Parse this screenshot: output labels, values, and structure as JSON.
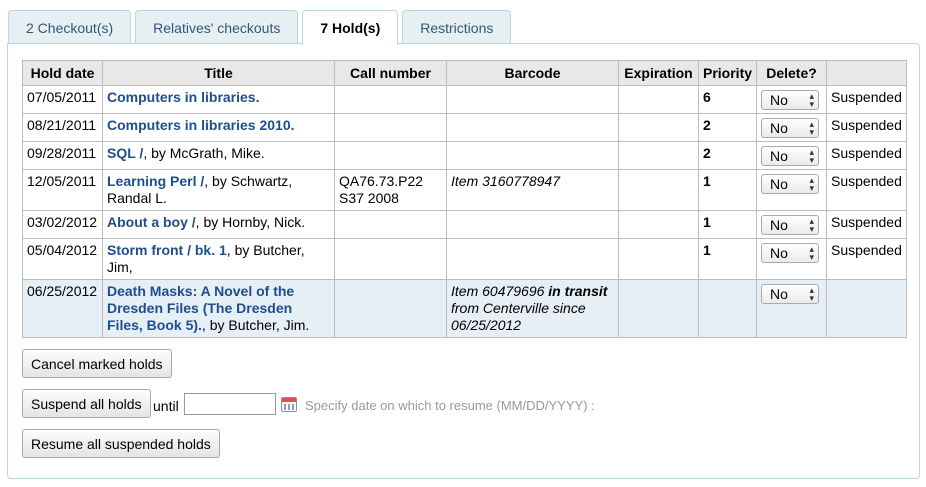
{
  "tabs": [
    {
      "label": "2 Checkout(s)"
    },
    {
      "label": "Relatives' checkouts"
    },
    {
      "label": "7 Hold(s)"
    },
    {
      "label": "Restrictions"
    }
  ],
  "columns": [
    "Hold date",
    "Title",
    "Call number",
    "Barcode",
    "Expiration",
    "Priority",
    "Delete?",
    ""
  ],
  "rows": [
    {
      "date": "07/05/2011",
      "title": "Computers in libraries.",
      "by": "",
      "call": "",
      "barcode": "",
      "barcode_bold": "",
      "barcode_rest": "",
      "expiration": "",
      "priority": "6",
      "delete": "No",
      "status": "Suspended"
    },
    {
      "date": "08/21/2011",
      "title": "Computers in libraries 2010.",
      "by": "",
      "call": "",
      "barcode": "",
      "barcode_bold": "",
      "barcode_rest": "",
      "expiration": "",
      "priority": "2",
      "delete": "No",
      "status": "Suspended"
    },
    {
      "date": "09/28/2011",
      "title": "SQL /",
      "by": ", by McGrath, Mike.",
      "call": "",
      "barcode": "",
      "barcode_bold": "",
      "barcode_rest": "",
      "expiration": "",
      "priority": "2",
      "delete": "No",
      "status": "Suspended"
    },
    {
      "date": "12/05/2011",
      "title": "Learning Perl /",
      "by": ", by Schwartz, Randal L.",
      "call": "QA76.73.P22 S37 2008",
      "barcode": "Item 3160778947",
      "barcode_bold": "",
      "barcode_rest": "",
      "expiration": "",
      "priority": "1",
      "delete": "No",
      "status": "Suspended"
    },
    {
      "date": "03/02/2012",
      "title": "About a boy /",
      "by": ", by Hornby, Nick.",
      "call": "",
      "barcode": "",
      "barcode_bold": "",
      "barcode_rest": "",
      "expiration": "",
      "priority": "1",
      "delete": "No",
      "status": "Suspended"
    },
    {
      "date": "05/04/2012",
      "title": "Storm front / bk. 1",
      "by": ", by Butcher, Jim,",
      "call": "",
      "barcode": "",
      "barcode_bold": "",
      "barcode_rest": "",
      "expiration": "",
      "priority": "1",
      "delete": "No",
      "status": "Suspended"
    },
    {
      "date": "06/25/2012",
      "title": "Death Masks: A Novel of the Dresden Files (The Dresden Files, Book 5).",
      "by": ", by Butcher, Jim.",
      "call": "",
      "barcode": "Item 60479696 ",
      "barcode_bold": "in transit",
      "barcode_rest": " from Centerville since 06/25/2012",
      "expiration": "",
      "priority": "",
      "delete": "No",
      "status": ""
    }
  ],
  "actions": {
    "cancel_label": "Cancel marked holds",
    "suspend_label": "Suspend all holds",
    "until_label": "until",
    "resume_date_value": "",
    "resume_hint": "Specify date on which to resume (MM/DD/YYYY) :",
    "resume_label": "Resume all suspended holds"
  },
  "icons": {
    "calendar": "calendar-icon"
  }
}
